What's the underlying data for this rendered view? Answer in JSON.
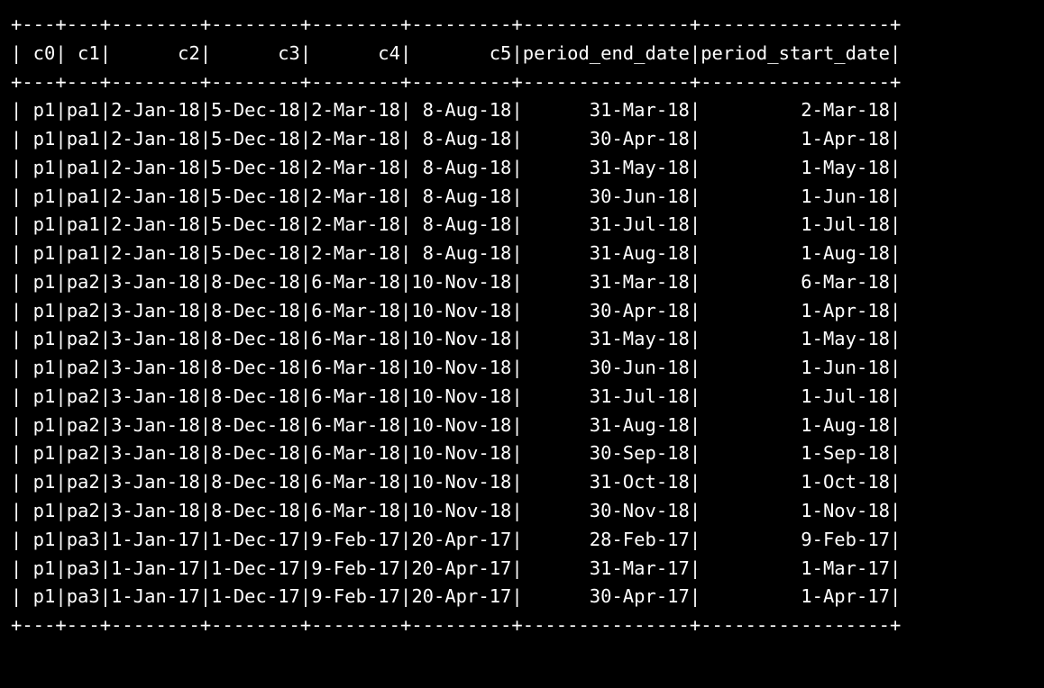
{
  "table": {
    "columns": [
      {
        "name": "c0",
        "width": 3,
        "align": "right"
      },
      {
        "name": "c1",
        "width": 3,
        "align": "right"
      },
      {
        "name": "c2",
        "width": 8,
        "align": "right"
      },
      {
        "name": "c3",
        "width": 8,
        "align": "right"
      },
      {
        "name": "c4",
        "width": 8,
        "align": "right"
      },
      {
        "name": "c5",
        "width": 9,
        "align": "right"
      },
      {
        "name": "period_end_date",
        "width": 15,
        "align": "right"
      },
      {
        "name": "period_start_date",
        "width": 17,
        "align": "right"
      }
    ],
    "rows": [
      [
        "p1",
        "pa1",
        "2-Jan-18",
        "5-Dec-18",
        "2-Mar-18",
        " 8-Aug-18",
        "31-Mar-18",
        "2-Mar-18"
      ],
      [
        "p1",
        "pa1",
        "2-Jan-18",
        "5-Dec-18",
        "2-Mar-18",
        " 8-Aug-18",
        "30-Apr-18",
        "1-Apr-18"
      ],
      [
        "p1",
        "pa1",
        "2-Jan-18",
        "5-Dec-18",
        "2-Mar-18",
        " 8-Aug-18",
        "31-May-18",
        "1-May-18"
      ],
      [
        "p1",
        "pa1",
        "2-Jan-18",
        "5-Dec-18",
        "2-Mar-18",
        " 8-Aug-18",
        "30-Jun-18",
        "1-Jun-18"
      ],
      [
        "p1",
        "pa1",
        "2-Jan-18",
        "5-Dec-18",
        "2-Mar-18",
        " 8-Aug-18",
        "31-Jul-18",
        "1-Jul-18"
      ],
      [
        "p1",
        "pa1",
        "2-Jan-18",
        "5-Dec-18",
        "2-Mar-18",
        " 8-Aug-18",
        "31-Aug-18",
        "1-Aug-18"
      ],
      [
        "p1",
        "pa2",
        "3-Jan-18",
        "8-Dec-18",
        "6-Mar-18",
        "10-Nov-18",
        "31-Mar-18",
        "6-Mar-18"
      ],
      [
        "p1",
        "pa2",
        "3-Jan-18",
        "8-Dec-18",
        "6-Mar-18",
        "10-Nov-18",
        "30-Apr-18",
        "1-Apr-18"
      ],
      [
        "p1",
        "pa2",
        "3-Jan-18",
        "8-Dec-18",
        "6-Mar-18",
        "10-Nov-18",
        "31-May-18",
        "1-May-18"
      ],
      [
        "p1",
        "pa2",
        "3-Jan-18",
        "8-Dec-18",
        "6-Mar-18",
        "10-Nov-18",
        "30-Jun-18",
        "1-Jun-18"
      ],
      [
        "p1",
        "pa2",
        "3-Jan-18",
        "8-Dec-18",
        "6-Mar-18",
        "10-Nov-18",
        "31-Jul-18",
        "1-Jul-18"
      ],
      [
        "p1",
        "pa2",
        "3-Jan-18",
        "8-Dec-18",
        "6-Mar-18",
        "10-Nov-18",
        "31-Aug-18",
        "1-Aug-18"
      ],
      [
        "p1",
        "pa2",
        "3-Jan-18",
        "8-Dec-18",
        "6-Mar-18",
        "10-Nov-18",
        "30-Sep-18",
        "1-Sep-18"
      ],
      [
        "p1",
        "pa2",
        "3-Jan-18",
        "8-Dec-18",
        "6-Mar-18",
        "10-Nov-18",
        "31-Oct-18",
        "1-Oct-18"
      ],
      [
        "p1",
        "pa2",
        "3-Jan-18",
        "8-Dec-18",
        "6-Mar-18",
        "10-Nov-18",
        "30-Nov-18",
        "1-Nov-18"
      ],
      [
        "p1",
        "pa3",
        "1-Jan-17",
        "1-Dec-17",
        "9-Feb-17",
        "20-Apr-17",
        "28-Feb-17",
        "9-Feb-17"
      ],
      [
        "p1",
        "pa3",
        "1-Jan-17",
        "1-Dec-17",
        "9-Feb-17",
        "20-Apr-17",
        "31-Mar-17",
        "1-Mar-17"
      ],
      [
        "p1",
        "pa3",
        "1-Jan-17",
        "1-Dec-17",
        "9-Feb-17",
        "20-Apr-17",
        "30-Apr-17",
        "1-Apr-17"
      ]
    ]
  }
}
